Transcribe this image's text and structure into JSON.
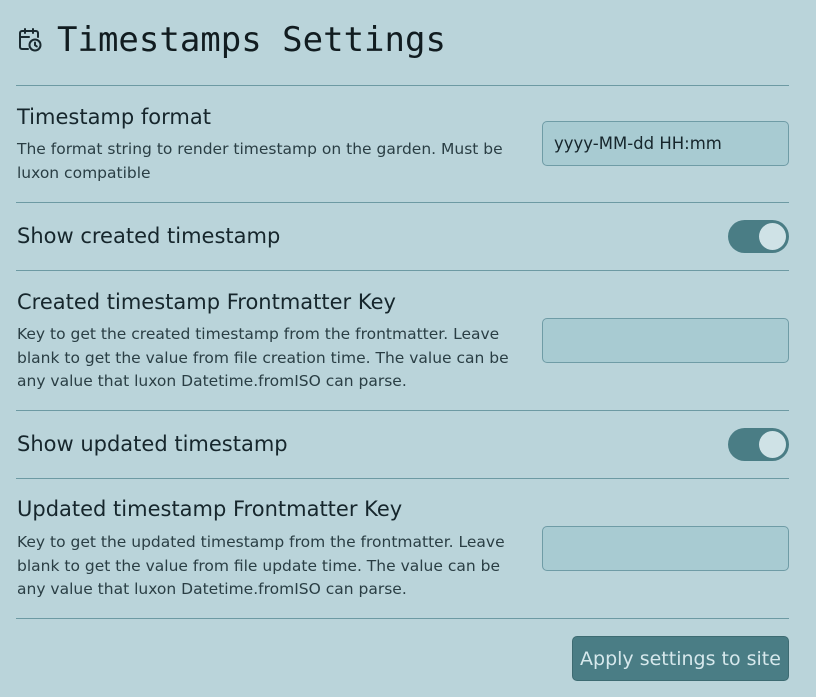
{
  "header": {
    "title": "Timestamps Settings",
    "icon": "calendar-clock-icon"
  },
  "settings": {
    "timestamp_format": {
      "name": "Timestamp format",
      "description": "The format string to render timestamp on the garden. Must be luxon compatible",
      "value": "yyyy-MM-dd HH:mm",
      "placeholder": ""
    },
    "show_created": {
      "name": "Show created timestamp",
      "enabled": true
    },
    "created_key": {
      "name": "Created timestamp Frontmatter Key",
      "description": "Key to get the created timestamp from the frontmatter. Leave blank to get the value from file creation time. The value can be any value that luxon Datetime.fromISO can parse.",
      "value": "",
      "placeholder": ""
    },
    "show_updated": {
      "name": "Show updated timestamp",
      "enabled": true
    },
    "updated_key": {
      "name": "Updated timestamp Frontmatter Key",
      "description": "Key to get the updated timestamp from the frontmatter. Leave blank to get the value from file update time. The value can be any value that luxon Datetime.fromISO can parse.",
      "value": "",
      "placeholder": ""
    }
  },
  "actions": {
    "apply_label": "Apply settings to site"
  },
  "colors": {
    "background": "#bad4da",
    "accent": "#4a7d85",
    "input_background": "#a8cbd2"
  }
}
